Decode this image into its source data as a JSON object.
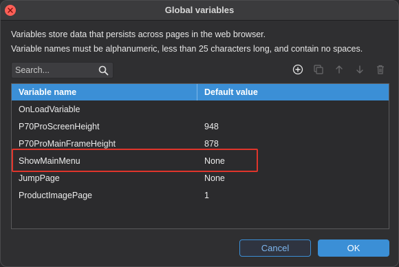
{
  "window": {
    "title": "Global variables"
  },
  "description": {
    "line1": "Variables store data that persists across pages in the web browser.",
    "line2": "Variable names must be alphanumeric, less than 25 characters long, and contain no spaces."
  },
  "search": {
    "placeholder": "Search..."
  },
  "toolbar": {
    "icons": [
      "add-icon",
      "duplicate-icon",
      "move-up-icon",
      "move-down-icon",
      "delete-icon"
    ]
  },
  "table": {
    "headers": {
      "name": "Variable name",
      "value": "Default value"
    },
    "rows": [
      {
        "name": "OnLoadVariable",
        "value": ""
      },
      {
        "name": "P70ProScreenHeight",
        "value": "948"
      },
      {
        "name": "P70ProMainFrameHeight",
        "value": "878"
      },
      {
        "name": "ShowMainMenu",
        "value": "None"
      },
      {
        "name": "JumpPage",
        "value": "None"
      },
      {
        "name": "ProductImagePage",
        "value": "1"
      }
    ],
    "highlighted_row": 3
  },
  "buttons": {
    "cancel": "Cancel",
    "ok": "OK"
  },
  "colors": {
    "accent": "#3b8fd6",
    "highlight": "#e0352b",
    "close": "#ff5f57"
  }
}
